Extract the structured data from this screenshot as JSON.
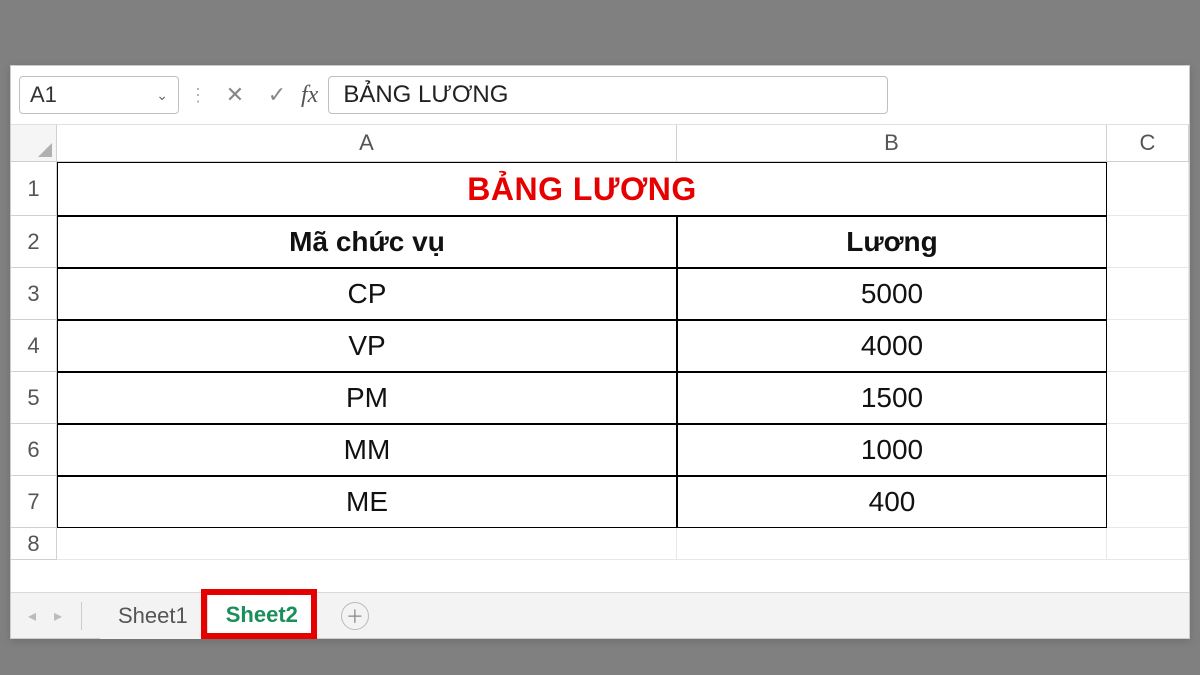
{
  "name_box": {
    "value": "A1"
  },
  "formula_bar": {
    "value": "BẢNG LƯƠNG",
    "fx": "fx"
  },
  "columns": [
    "A",
    "B",
    "C"
  ],
  "rows_labels": [
    "1",
    "2",
    "3",
    "4",
    "5",
    "6",
    "7",
    "8"
  ],
  "title": "BẢNG LƯƠNG",
  "headers": {
    "code": "Mã chức vụ",
    "salary": "Lương"
  },
  "table": [
    {
      "code": "CP",
      "salary": "5000"
    },
    {
      "code": "VP",
      "salary": "4000"
    },
    {
      "code": "PM",
      "salary": "1500"
    },
    {
      "code": "MM",
      "salary": "1000"
    },
    {
      "code": "ME",
      "salary": "400"
    }
  ],
  "sheets": {
    "tab1": "Sheet1",
    "tab2": "Sheet2"
  },
  "icons": {
    "cancel": "✕",
    "enter": "✓",
    "chev": "⌄",
    "plus": "＋",
    "left": "◂",
    "right": "▸"
  }
}
